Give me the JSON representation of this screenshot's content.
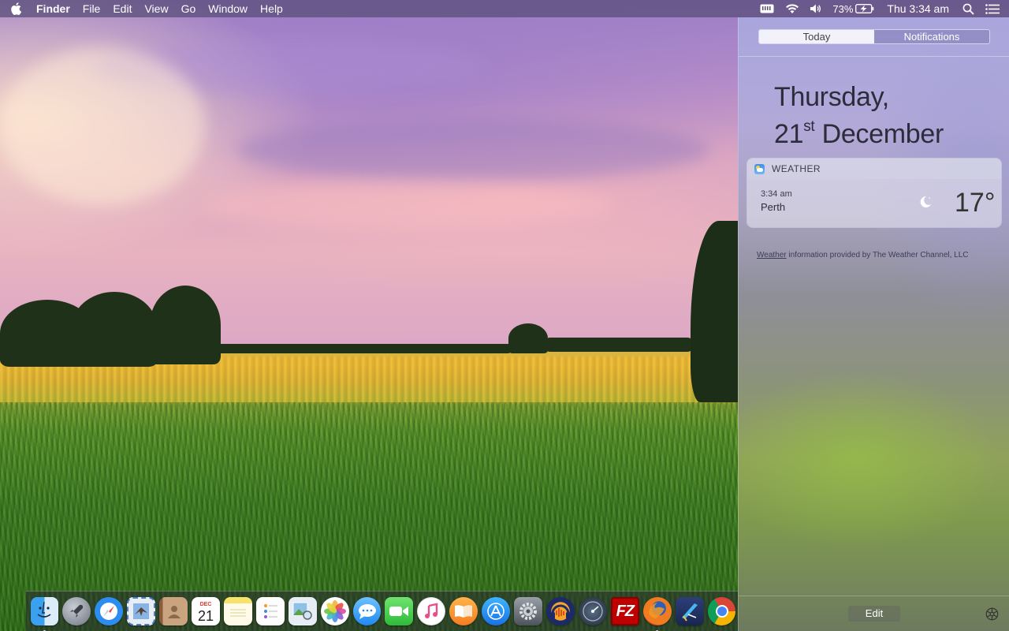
{
  "menubar": {
    "app_name": "Finder",
    "menus": [
      "File",
      "Edit",
      "View",
      "Go",
      "Window",
      "Help"
    ],
    "battery_percent": "73%",
    "clock": "Thu 3:34 am"
  },
  "notification_center": {
    "tabs": [
      "Today",
      "Notifications"
    ],
    "date_line1": "Thursday,",
    "date_day": "21",
    "date_suffix": "st",
    "date_month": "December",
    "weather": {
      "header": "WEATHER",
      "time": "3:34 am",
      "city": "Perth",
      "temperature": "17°",
      "condition_icon": "moon-icon"
    },
    "credit_link": "Weather",
    "credit_text": " information provided by The Weather Channel, LLC",
    "edit_label": "Edit"
  },
  "dock": {
    "apps": [
      {
        "name": "finder-icon",
        "running": true
      },
      {
        "name": "launchpad-icon",
        "running": false
      },
      {
        "name": "safari-icon",
        "running": false
      },
      {
        "name": "mail-icon",
        "running": false
      },
      {
        "name": "contacts-icon",
        "running": false
      },
      {
        "name": "calendar-icon",
        "running": false,
        "month": "DEC",
        "day": "21"
      },
      {
        "name": "notes-icon",
        "running": false
      },
      {
        "name": "reminders-icon",
        "running": false
      },
      {
        "name": "preview-icon",
        "running": false
      },
      {
        "name": "photos-icon",
        "running": false
      },
      {
        "name": "messages-icon",
        "running": false
      },
      {
        "name": "facetime-icon",
        "running": false
      },
      {
        "name": "itunes-icon",
        "running": false
      },
      {
        "name": "ibooks-icon",
        "running": false
      },
      {
        "name": "app-store-icon",
        "running": false
      },
      {
        "name": "system-preferences-icon",
        "running": false
      },
      {
        "name": "audacity-icon",
        "running": false
      },
      {
        "name": "disk-utility-icon",
        "running": false
      },
      {
        "name": "filezilla-icon",
        "running": false,
        "label": "FZ"
      },
      {
        "name": "firefox-icon",
        "running": true
      },
      {
        "name": "xcode-icon",
        "running": false
      },
      {
        "name": "chrome-icon",
        "running": false
      }
    ]
  },
  "colors": {
    "menubar": "#5a4e78",
    "accent_filezilla": "#bf0000",
    "chrome_red": "#db4437",
    "chrome_yellow": "#f4b400",
    "chrome_green": "#0f9d58"
  }
}
